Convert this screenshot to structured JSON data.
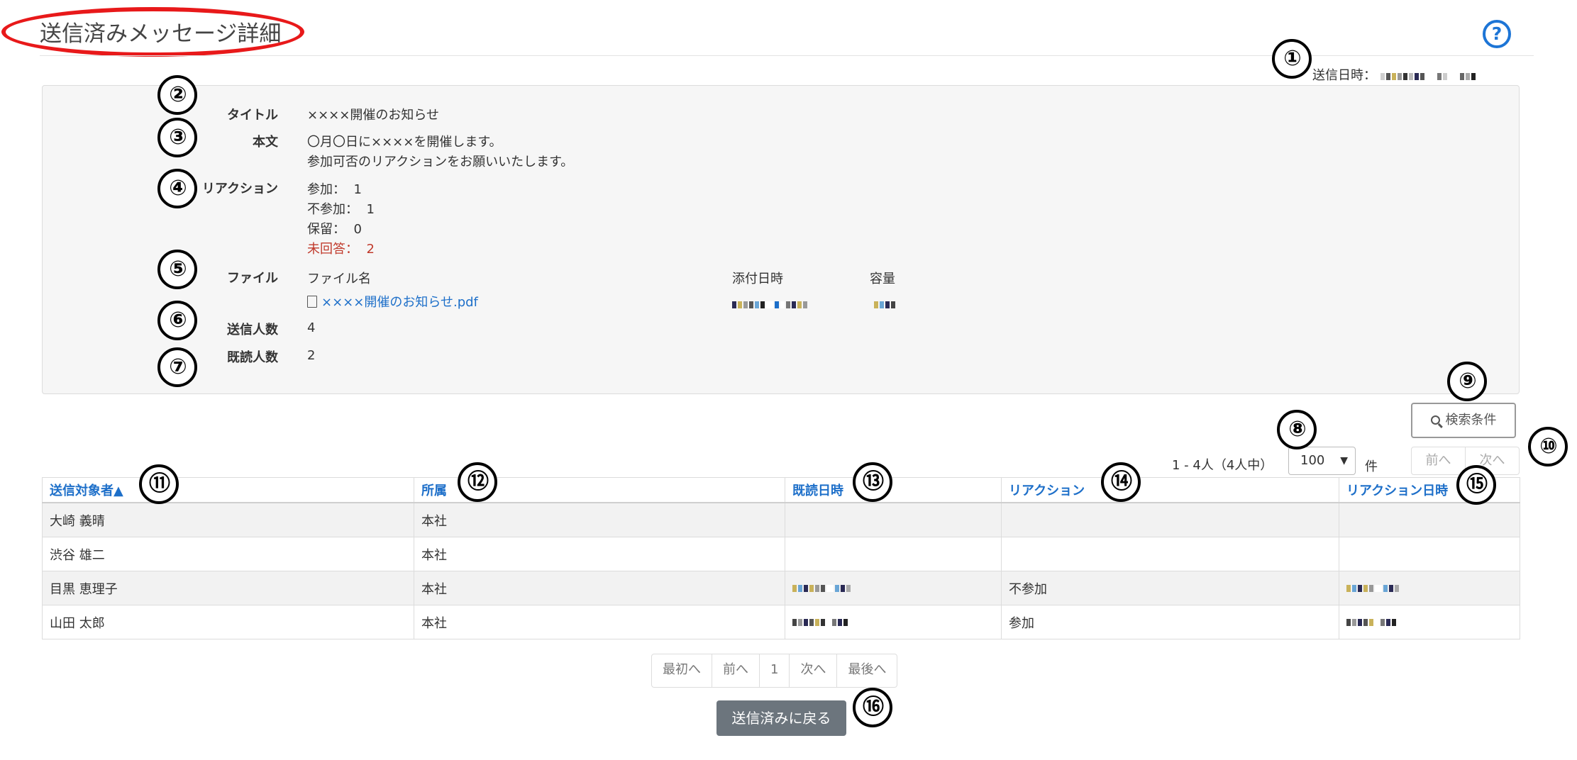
{
  "header": {
    "title": "送信済みメッセージ詳細",
    "help_glyph": "?",
    "sent_date_label": "送信日時："
  },
  "badges": [
    "①",
    "②",
    "③",
    "④",
    "⑤",
    "⑥",
    "⑦",
    "⑧",
    "⑨",
    "⑩",
    "⑪",
    "⑫",
    "⑬",
    "⑭",
    "⑮",
    "⑯"
  ],
  "detail": {
    "title_label": "タイトル",
    "title_value": "××××開催のお知らせ",
    "body_label": "本文",
    "body_line1": "〇月〇日に××××を開催します。",
    "body_line2": "参加可否のリアクションをお願いいたします。",
    "reaction_label": "リアクション",
    "reactions": [
      {
        "label": "参加：",
        "count": "1"
      },
      {
        "label": "不参加：",
        "count": "1"
      },
      {
        "label": "保留：",
        "count": "0"
      },
      {
        "label": "未回答：",
        "count": "2"
      }
    ],
    "file_label": "ファイル",
    "file_col_name": "ファイル名",
    "file_col_date": "添付日時",
    "file_col_size": "容量",
    "file_name": "××××開催のお知らせ.pdf",
    "sent_count_label": "送信人数",
    "sent_count": "4",
    "read_count_label": "既読人数",
    "read_count": "2"
  },
  "controls": {
    "search_label": "検索条件",
    "range_text": "1 - 4人（4人中）",
    "per_page": "100",
    "per_page_unit": "件",
    "prev": "前へ",
    "next": "次へ"
  },
  "table": {
    "headers": [
      "送信対象者▲",
      "所属",
      "既読日時",
      "リアクション",
      "リアクション日時"
    ],
    "rows": [
      {
        "name": "大崎 義晴",
        "dept": "本社",
        "reaction": ""
      },
      {
        "name": "渋谷 雄二",
        "dept": "本社",
        "reaction": ""
      },
      {
        "name": "目黒 恵理子",
        "dept": "本社",
        "reaction": "不参加"
      },
      {
        "name": "山田 太郎",
        "dept": "本社",
        "reaction": "参加"
      }
    ]
  },
  "pagination": {
    "first": "最初へ",
    "prev": "前へ",
    "page": "1",
    "next": "次へ",
    "last": "最後へ"
  },
  "back_button": "送信済みに戻る",
  "colors": {
    "accent_blue": "#1d6fc9",
    "annotation_red": "#e8191a",
    "unanswered_red": "#c0392b",
    "back_button_gray": "#6c757d"
  }
}
